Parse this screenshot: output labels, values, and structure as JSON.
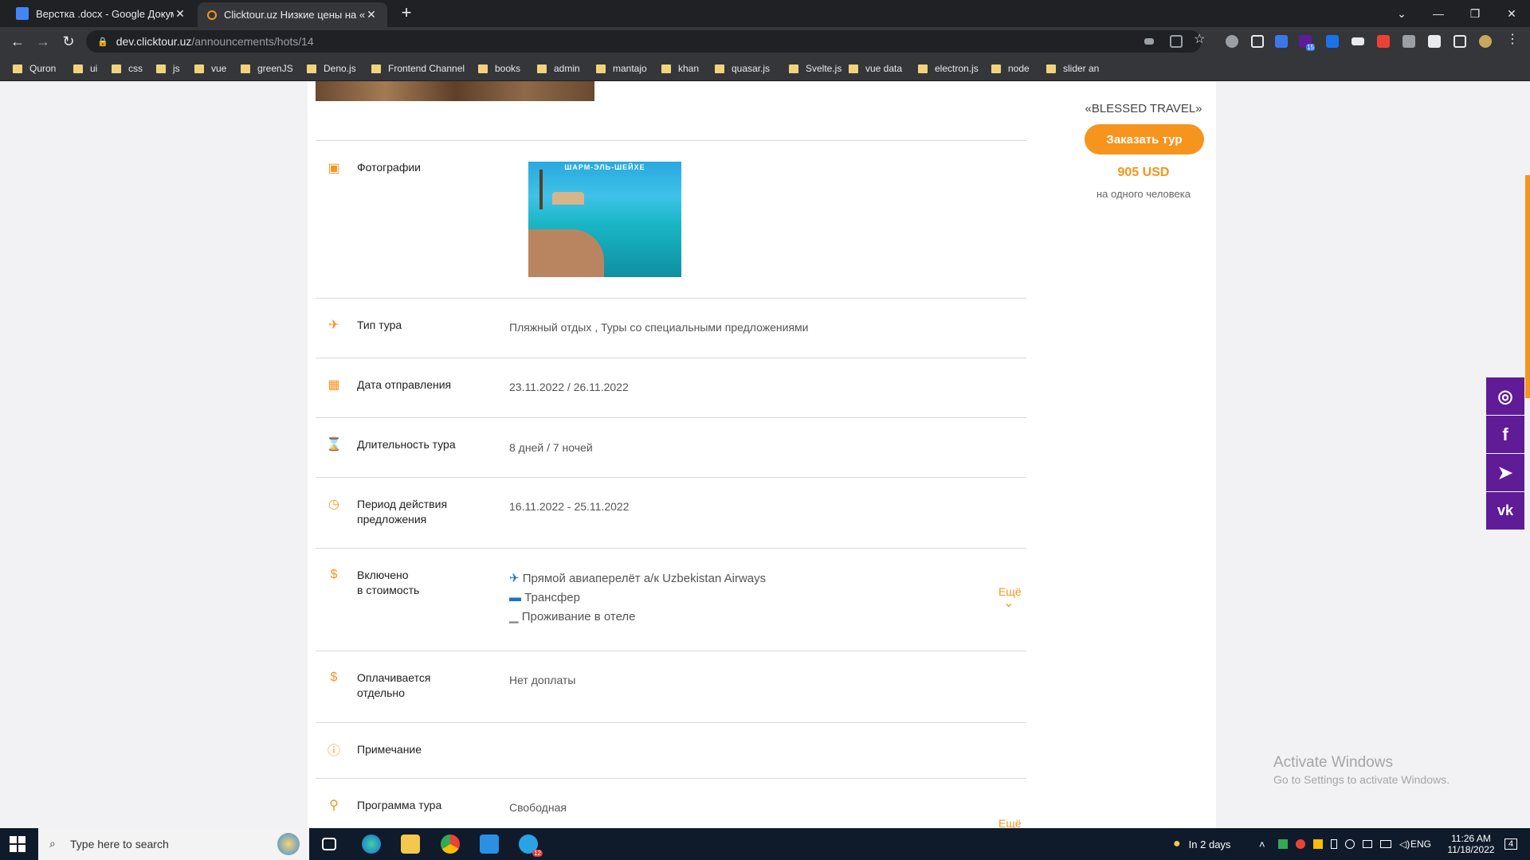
{
  "browser": {
    "tabs": [
      {
        "title": "Верстка .docx - Google Докумен",
        "close": "✕"
      },
      {
        "title": "Clicktour.uz Низкие цены на «вы",
        "close": "✕"
      }
    ],
    "new_tab": "+",
    "window_controls": {
      "minimize": "—",
      "maximize": "❐",
      "close": "✕",
      "tablist": "⌄"
    },
    "nav": {
      "back": "←",
      "forward": "→",
      "reload": "↻"
    },
    "url_domain": "dev.clicktour.uz",
    "url_path": "/announcements/hots/14",
    "bookmarks": [
      "Quron",
      "ui",
      "css",
      "js",
      "vue",
      "greenJS",
      "Deno.js",
      "Frontend Channel",
      "books",
      "admin",
      "mantajo",
      "khan",
      "quasar.js",
      "Svelte.js",
      "vue data",
      "electron.js",
      "node",
      "slider an"
    ],
    "extension_badge": "15"
  },
  "details": {
    "photos": {
      "label": "Фотографии",
      "photo_caption": "ШАРМ-ЭЛЬ-ШЕЙХЕ"
    },
    "tour_type": {
      "label": "Тип тура",
      "value": "Пляжный отдых , Туры со специальными предложениями"
    },
    "departure": {
      "label": "Дата отправления",
      "value": "23.11.2022 / 26.11.2022"
    },
    "duration": {
      "label": "Длительность тура",
      "value": "8 дней / 7 ночей"
    },
    "validity": {
      "label_1": "Период действия",
      "label_2": "предложения",
      "value": "16.11.2022 - 25.11.2022"
    },
    "included": {
      "label_1": "Включено",
      "label_2": "в стоимость",
      "items": [
        "Прямой авиаперелёт а/к Uzbekistan Airways",
        "Трансфер",
        "Проживание в отеле"
      ],
      "more": "Ещё",
      "more_chevron": "⌄"
    },
    "paid_separately": {
      "label_1": "Оплачивается",
      "label_2": "отдельно",
      "value": "Нет доплаты"
    },
    "note": {
      "label": "Примечание"
    },
    "program": {
      "label": "Программа тура",
      "value": "Свободная",
      "more": "Ещё"
    }
  },
  "sidebar": {
    "agency": "«BLESSED TRAVEL»",
    "order_button": "Заказать тур",
    "price": "905 USD",
    "per_person": "на одного человека"
  },
  "social": [
    {
      "name": "instagram",
      "glyph": "◎"
    },
    {
      "name": "facebook",
      "glyph": "f"
    },
    {
      "name": "telegram",
      "glyph": "➤"
    },
    {
      "name": "vk",
      "glyph": "vk"
    }
  ],
  "watermark": {
    "line1": "Activate Windows",
    "line2": "Go to Settings to activate Windows."
  },
  "taskbar": {
    "search_placeholder": "Type here to search",
    "weather": "In 2 days",
    "lang": "ENG",
    "time": "11:26 AM",
    "date": "11/18/2022",
    "telegram_badge": "12",
    "notif_count": "4"
  },
  "colors": {
    "accent": "#f7941d",
    "social": "#5f1c96",
    "chrome_dark": "#202124"
  }
}
